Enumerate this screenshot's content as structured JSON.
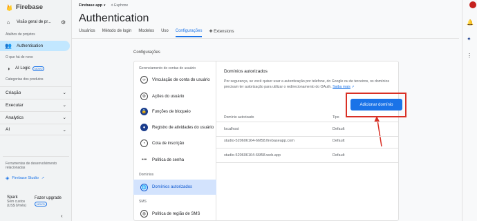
{
  "brand": "Firebase",
  "project": {
    "name": "Firebase app",
    "environment": "Euphone"
  },
  "sidebar": {
    "overview": "Visão geral de pr...",
    "pinned_label": "Atalhos de projetos",
    "authentication": "Authentication",
    "whats_new": "O que há de novo",
    "ai_logic": "AI Logic",
    "ai_logic_badge": "NOVO",
    "categories_label": "Categorias dos produtos",
    "sections": [
      "Criação",
      "Executar",
      "Analytics",
      "AI"
    ],
    "dev_tools": "Ferramentas de desenvolvimento relacionadas",
    "studio": "Firebase Studio",
    "plan_name": "Spark",
    "plan_detail": "Sem custos",
    "plan_price": "(US$ 0/mês)",
    "upgrade": "Fazer upgrade",
    "upgrade_badge": "NOVO"
  },
  "page_title": "Authentication",
  "tabs": [
    "Usuários",
    "Método de login",
    "Modelos",
    "Uso",
    "Configurações",
    "Extensions"
  ],
  "active_tab": "Configurações",
  "content": {
    "section_title": "Configurações",
    "nav_group_1": "Gerenciamento de contas do usuário",
    "nav_items_1": [
      {
        "label": "Vinculação de conta do usuário",
        "icon": "link-icon"
      },
      {
        "label": "Ações do usuário",
        "icon": "gear-icon"
      },
      {
        "label": "Funções de bloqueio",
        "icon": "lock-icon"
      },
      {
        "label": "Registro de atividades do usuário",
        "icon": "activity-icon"
      },
      {
        "label": "Cota de inscrição",
        "icon": "speed-icon"
      },
      {
        "label": "Política de senha",
        "icon": "password-icon"
      }
    ],
    "nav_group_2": "Domínios",
    "nav_item_domains": "Domínios autorizados",
    "nav_group_3": "SMS",
    "nav_item_sms": "Política de região de SMS",
    "panel_title": "Domínios autorizados",
    "panel_desc": "Por segurança, se você quiser usar a autenticação por telefone, do Google ou de terceiros, os domínios precisam ter autorização para utilizar o redirecionamento do OAuth.",
    "learn_more": "Saiba mais",
    "add_button": "Adicionar domínio",
    "table_headers": [
      "Domínio autorizado",
      "Tipo"
    ],
    "rows": [
      {
        "domain": "localhost",
        "type": "Default"
      },
      {
        "domain": "studio-520606164-66f58.firebaseapp.com",
        "type": "Default"
      },
      {
        "domain": "studio-520606164-66f58.web.app",
        "type": "Default"
      }
    ]
  },
  "colors": {
    "accent": "#1a73e8",
    "highlight": "#d93025",
    "active_bg": "#d3e3fd"
  }
}
